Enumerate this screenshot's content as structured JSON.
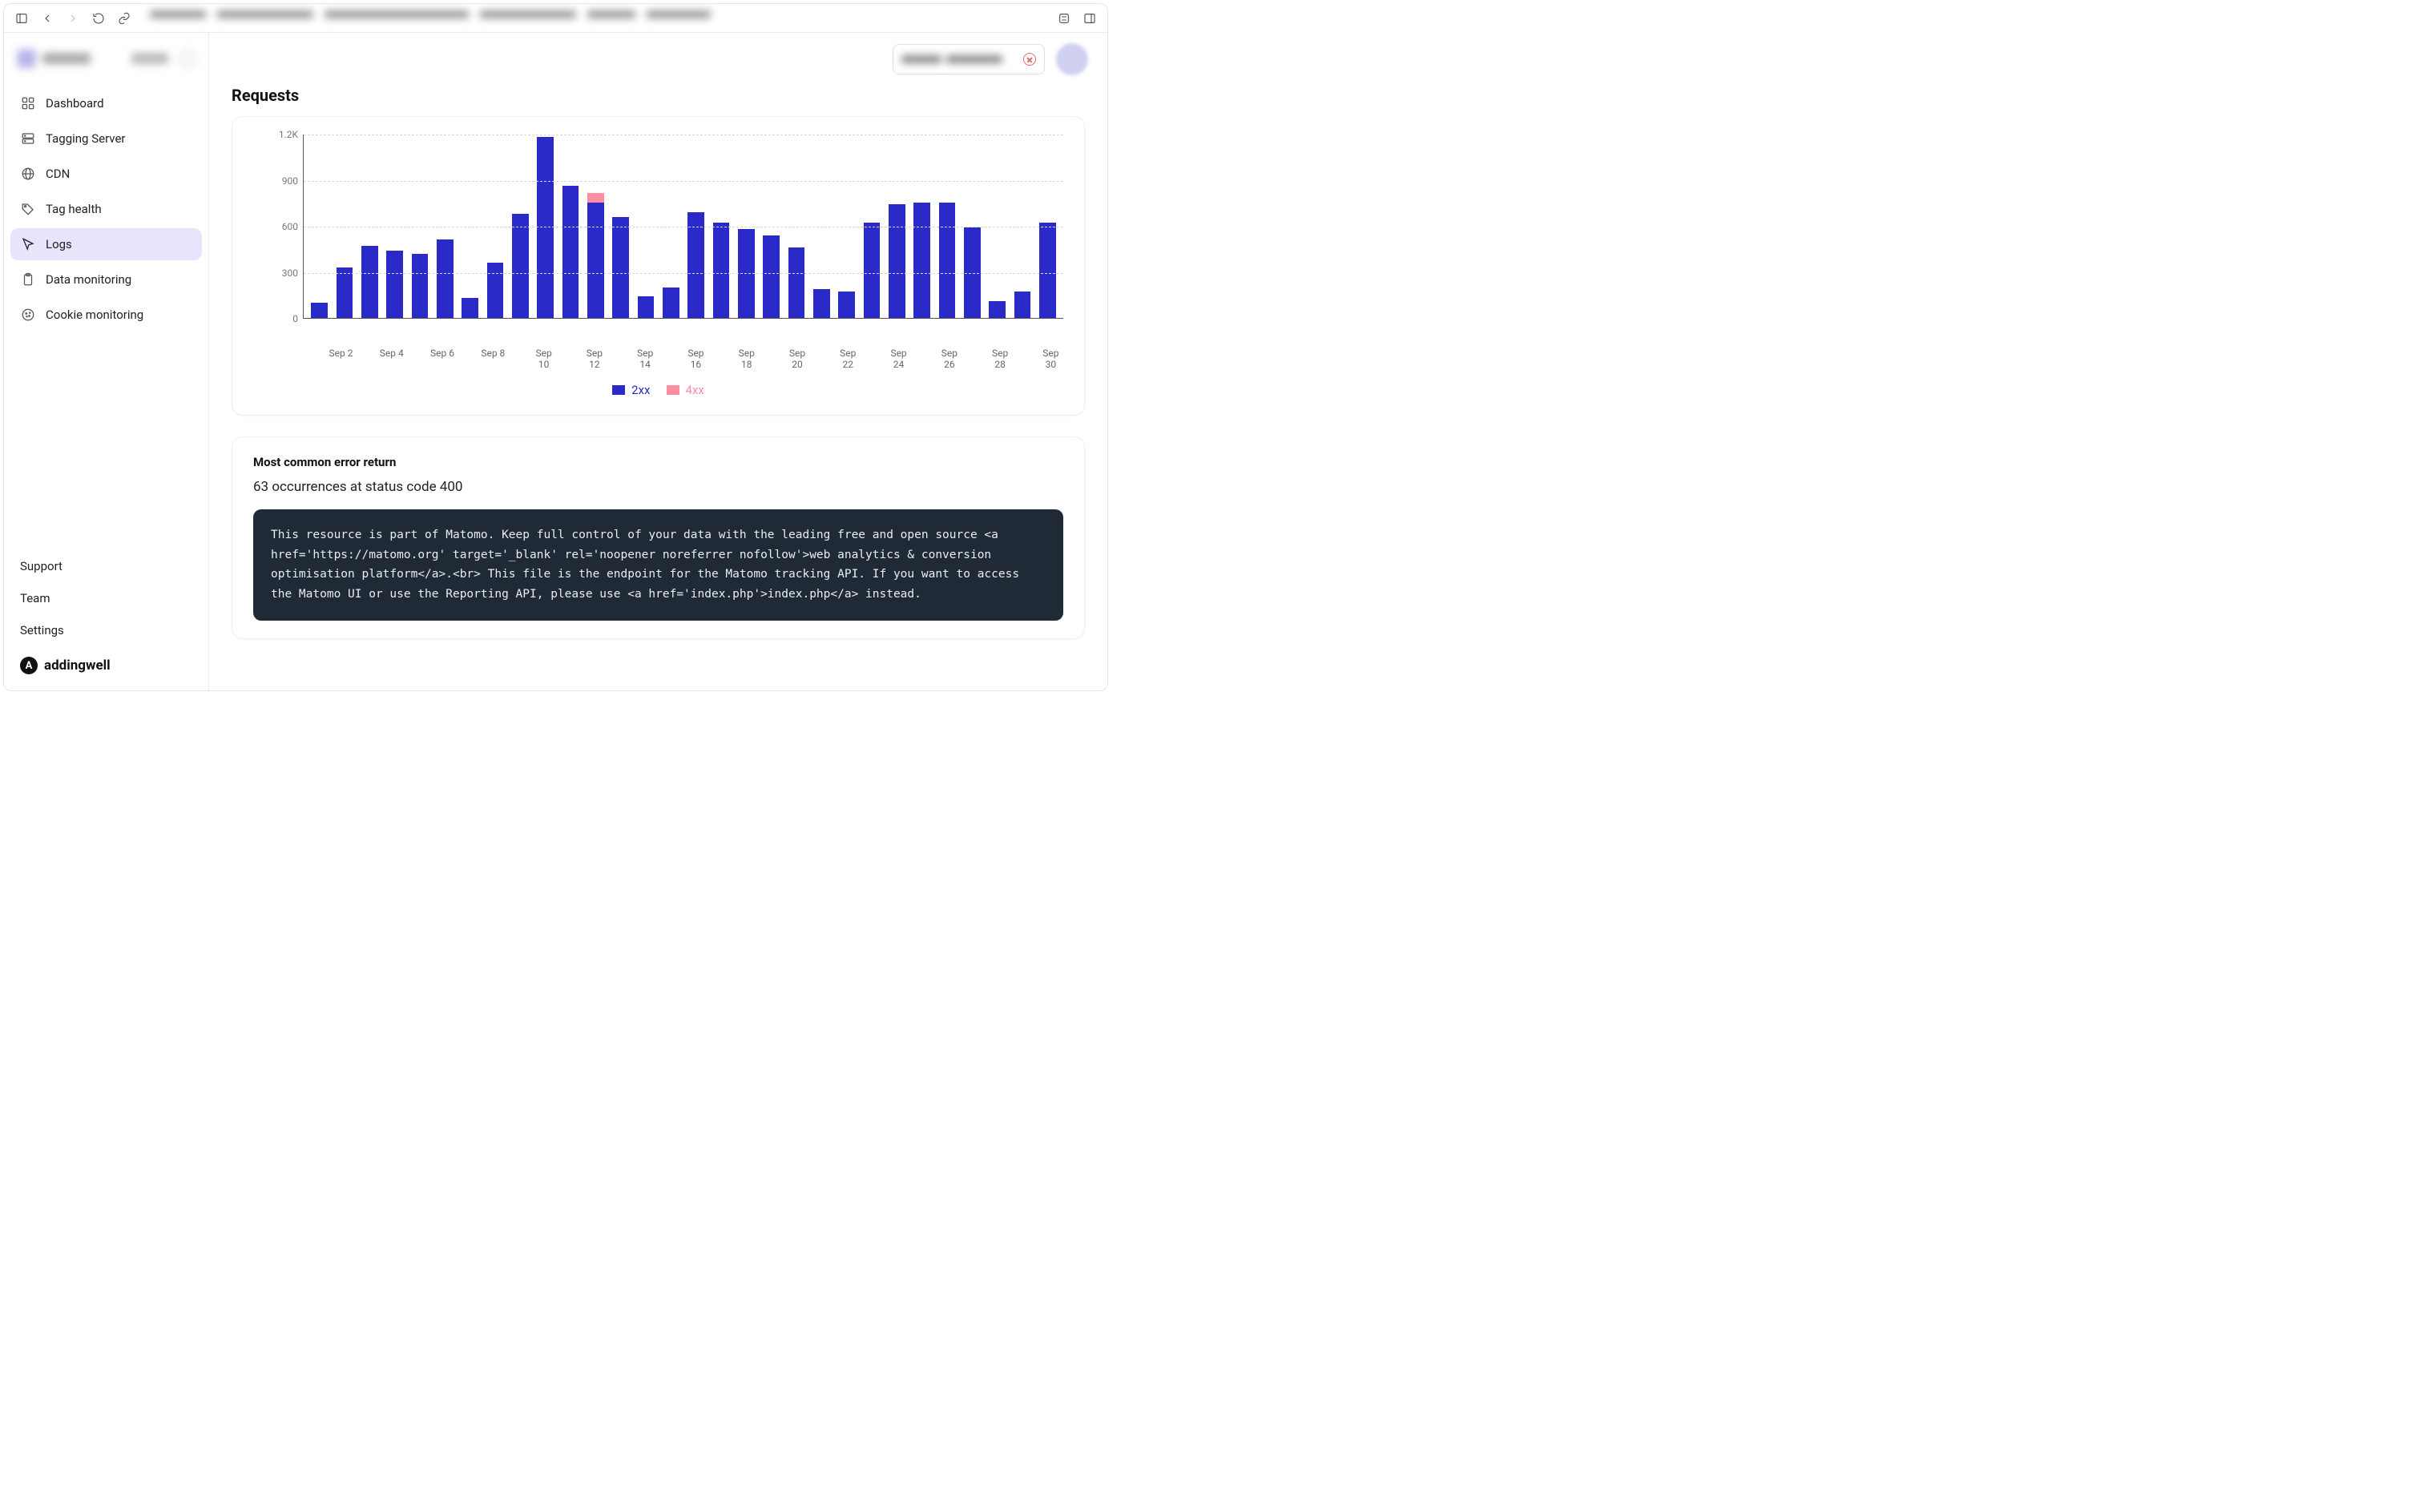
{
  "sidebar": {
    "items": [
      {
        "label": "Dashboard",
        "icon": "dashboard-icon"
      },
      {
        "label": "Tagging Server",
        "icon": "server-icon"
      },
      {
        "label": "CDN",
        "icon": "globe-icon"
      },
      {
        "label": "Tag health",
        "icon": "tag-icon"
      },
      {
        "label": "Logs",
        "icon": "cursor-icon",
        "active": true
      },
      {
        "label": "Data monitoring",
        "icon": "clipboard-icon"
      },
      {
        "label": "Cookie monitoring",
        "icon": "cookie-icon"
      }
    ],
    "footer_links": [
      "Support",
      "Team",
      "Settings"
    ],
    "brand": "addingwell"
  },
  "page": {
    "title": "Requests",
    "error_panel": {
      "heading": "Most common error return",
      "summary": "63 occurrences at status code 400",
      "body": "This resource is part of Matomo. Keep full control of your data with the leading free and open source <a href='https://matomo.org' target='_blank' rel='noopener noreferrer nofollow'>web analytics & conversion optimisation platform</a>.<br> This file is the endpoint for the Matomo tracking API. If you want to access the Matomo UI or use the Reporting API, please use <a href='index.php'>index.php</a> instead."
    }
  },
  "chart_data": {
    "type": "bar",
    "title": "Requests",
    "xlabel": "",
    "ylabel": "",
    "ylim": [
      0,
      1200
    ],
    "yticks": [
      0,
      300,
      600,
      900,
      "1.2K"
    ],
    "categories": [
      "Sep 1",
      "Sep 2",
      "Sep 3",
      "Sep 4",
      "Sep 5",
      "Sep 6",
      "Sep 7",
      "Sep 8",
      "Sep 9",
      "Sep 10",
      "Sep 11",
      "Sep 12",
      "Sep 13",
      "Sep 14",
      "Sep 15",
      "Sep 16",
      "Sep 17",
      "Sep 18",
      "Sep 19",
      "Sep 20",
      "Sep 21",
      "Sep 22",
      "Sep 23",
      "Sep 24",
      "Sep 25",
      "Sep 26",
      "Sep 27",
      "Sep 28",
      "Sep 29",
      "Sep 30"
    ],
    "x_tick_labels": [
      "Sep 2",
      "Sep 4",
      "Sep 6",
      "Sep 8",
      "Sep 10",
      "Sep 12",
      "Sep 14",
      "Sep 16",
      "Sep 18",
      "Sep 20",
      "Sep 22",
      "Sep 24",
      "Sep 26",
      "Sep 28",
      "Sep 30"
    ],
    "series": [
      {
        "name": "2xx",
        "color": "#2a2ac9",
        "values": [
          100,
          330,
          470,
          440,
          420,
          510,
          130,
          360,
          680,
          1180,
          860,
          750,
          660,
          140,
          200,
          690,
          620,
          580,
          540,
          460,
          190,
          170,
          620,
          740,
          750,
          750,
          590,
          110,
          170,
          620
        ]
      },
      {
        "name": "4xx",
        "color": "#fd8ea1",
        "values": [
          0,
          0,
          0,
          0,
          0,
          0,
          0,
          0,
          0,
          0,
          0,
          63,
          0,
          0,
          0,
          0,
          0,
          0,
          0,
          0,
          0,
          0,
          0,
          0,
          0,
          0,
          0,
          0,
          0,
          0
        ]
      }
    ],
    "legend": [
      "2xx",
      "4xx"
    ]
  }
}
